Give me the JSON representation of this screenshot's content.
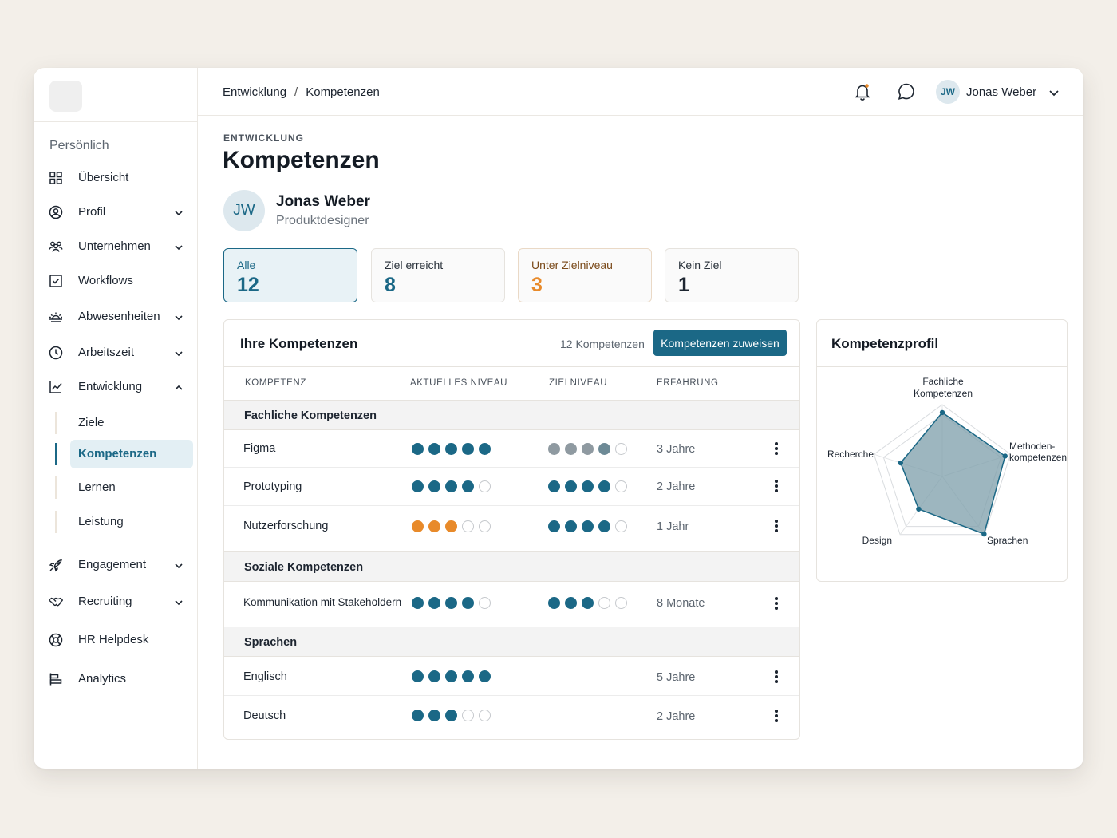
{
  "breadcrumb": {
    "parent": "Entwicklung",
    "separator": "/",
    "current": "Kompetenzen"
  },
  "user": {
    "initials": "JW",
    "name": "Jonas Weber"
  },
  "sidebar": {
    "section": "Persönlich",
    "items": [
      {
        "label": "Übersicht",
        "icon": "grid-icon"
      },
      {
        "label": "Profil",
        "icon": "user-circle-icon"
      },
      {
        "label": "Unternehmen",
        "icon": "users-icon"
      },
      {
        "label": "Workflows",
        "icon": "checkbox-icon"
      },
      {
        "label": "Abwesenheiten",
        "icon": "sunrise-icon"
      },
      {
        "label": "Arbeitszeit",
        "icon": "clock-icon"
      },
      {
        "label": "Entwicklung",
        "icon": "chart-line-icon"
      },
      {
        "label": "Engagement",
        "icon": "rocket-icon"
      },
      {
        "label": "Recruiting",
        "icon": "handshake-icon"
      },
      {
        "label": "HR Helpdesk",
        "icon": "lifebuoy-icon"
      },
      {
        "label": "Analytics",
        "icon": "analytics-icon"
      }
    ],
    "sub_items": [
      {
        "label": "Ziele"
      },
      {
        "label": "Kompetenzen"
      },
      {
        "label": "Lernen"
      },
      {
        "label": "Leistung"
      }
    ]
  },
  "page": {
    "eyebrow": "ENTWICKLUNG",
    "title": "Kompetenzen",
    "person_initials": "JW",
    "person_name": "Jonas Weber",
    "person_role": "Produktdesigner"
  },
  "stats": [
    {
      "label": "Alle",
      "value": "12"
    },
    {
      "label": "Ziel erreicht",
      "value": "8"
    },
    {
      "label": "Unter Zielniveau",
      "value": "3"
    },
    {
      "label": "Kein Ziel",
      "value": "1"
    }
  ],
  "competencies": {
    "title": "Ihre Kompetenzen",
    "count": "12 Kompetenzen",
    "assign_label": "Kompetenzen zuweisen",
    "columns": [
      "KOMPETENZ",
      "AKTUELLES NIVEAU",
      "ZIELNIVEAU",
      "ERFAHRUNG"
    ],
    "groups": [
      {
        "name": "Fachliche Kompetenzen",
        "rows": [
          {
            "name": "Figma",
            "current": 5,
            "target": 4,
            "experience": "3 Jahre"
          },
          {
            "name": "Prototyping",
            "current": 4,
            "target": 4,
            "experience": "2 Jahre"
          },
          {
            "name": "Nutzerforschung",
            "current": 3,
            "target": 4,
            "experience": "1 Jahr"
          }
        ]
      },
      {
        "name": "Soziale Kompetenzen",
        "rows": [
          {
            "name": "Kommunikation mit Stakeholdern",
            "current": 4,
            "target": 3,
            "experience": "8 Monate"
          }
        ]
      },
      {
        "name": "Sprachen",
        "rows": [
          {
            "name": "Englisch",
            "current": 5,
            "target_text": "—",
            "experience": "5 Jahre"
          },
          {
            "name": "Deutsch",
            "current": 3,
            "target_text": "—",
            "experience": "2 Jahre"
          }
        ]
      }
    ]
  },
  "profile": {
    "title": "Kompetenzprofil",
    "labels": {
      "top_line1": "Fachliche",
      "top_line2": "Kompetenzen",
      "right_line1": "Methoden-",
      "right_line2": "kompetenzen",
      "bottom_right": "Sprachen",
      "bottom_left": "Design",
      "left": "Recherche"
    }
  },
  "chart_data": {
    "type": "radar",
    "title": "Kompetenzprofil",
    "categories": [
      "Fachliche Kompetenzen",
      "Methoden-kompetenzen",
      "Sprachen",
      "Design",
      "Recherche"
    ],
    "values": [
      0.89,
      0.92,
      0.99,
      0.56,
      0.61
    ],
    "range": [
      0,
      1
    ],
    "rings": 2
  },
  "colors": {
    "accent": "#1b6886",
    "warning": "#e88a2a",
    "background": "#f3efe9"
  }
}
